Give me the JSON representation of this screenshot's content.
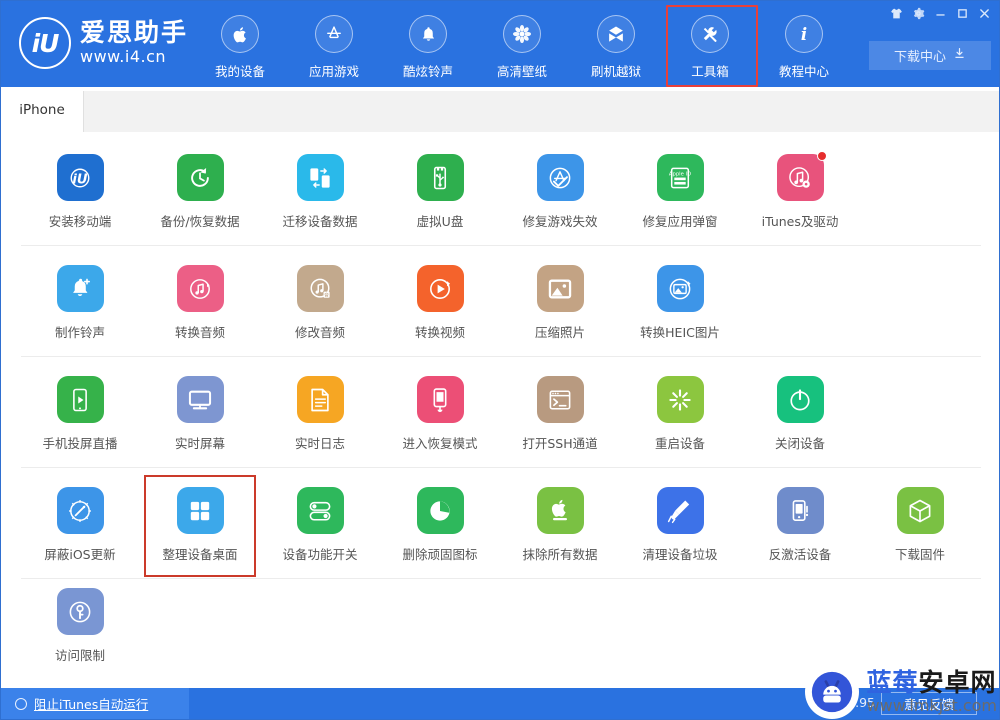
{
  "window": {
    "controls": [
      {
        "name": "skin-icon",
        "label": "换肤"
      },
      {
        "name": "settings-gear-icon",
        "label": "设置"
      },
      {
        "name": "minimize-icon",
        "label": "最小化"
      },
      {
        "name": "maximize-icon",
        "label": "最大化"
      },
      {
        "name": "close-icon",
        "label": "关闭"
      }
    ]
  },
  "brand": {
    "mark": "iU",
    "name": "爱思助手",
    "url": "www.i4.cn"
  },
  "nav": {
    "items": [
      {
        "label": "我的设备",
        "icon": "apple-icon",
        "highlighted": false
      },
      {
        "label": "应用游戏",
        "icon": "appstore-icon",
        "highlighted": false
      },
      {
        "label": "酷炫铃声",
        "icon": "bell-icon",
        "highlighted": false
      },
      {
        "label": "高清壁纸",
        "icon": "flower-icon",
        "highlighted": false
      },
      {
        "label": "刷机越狱",
        "icon": "box-icon",
        "highlighted": false
      },
      {
        "label": "工具箱",
        "icon": "wrench-icon",
        "highlighted": true
      },
      {
        "label": "教程中心",
        "icon": "info-icon",
        "highlighted": false
      }
    ],
    "download_center": {
      "label": "下载中心",
      "icon": "download-icon"
    }
  },
  "tabs": {
    "items": [
      {
        "label": "iPhone",
        "active": true
      }
    ]
  },
  "toolbox": {
    "rows": [
      {
        "items": [
          {
            "label": "安装移动端",
            "icon": "iu-app-icon",
            "color": "#1f6fd0",
            "badge": false
          },
          {
            "label": "备份/恢复数据",
            "icon": "backup-clock-icon",
            "color": "#2eaf4e",
            "badge": false
          },
          {
            "label": "迁移设备数据",
            "icon": "migrate-icon",
            "color": "#2ab9ea",
            "badge": false
          },
          {
            "label": "虚拟U盘",
            "icon": "usb-drive-icon",
            "color": "#2eaf4e",
            "badge": false
          },
          {
            "label": "修复游戏失效",
            "icon": "appstore-fix-icon",
            "color": "#3d95e8",
            "badge": false
          },
          {
            "label": "修复应用弹窗",
            "icon": "appleid-card-icon",
            "color": "#2eb85c",
            "badge": false
          },
          {
            "label": "iTunes及驱动",
            "icon": "itunes-gear-icon",
            "color": "#e8537c",
            "badge": true
          }
        ]
      },
      {
        "items": [
          {
            "label": "制作铃声",
            "icon": "bell-plus-icon",
            "color": "#3ca8ea",
            "badge": false
          },
          {
            "label": "转换音频",
            "icon": "audio-convert-icon",
            "color": "#ec5f86",
            "badge": false
          },
          {
            "label": "修改音频",
            "icon": "audio-edit-icon",
            "color": "#c2a98d",
            "badge": false
          },
          {
            "label": "转换视频",
            "icon": "video-convert-icon",
            "color": "#f4632c",
            "badge": false
          },
          {
            "label": "压缩照片",
            "icon": "photo-compress-icon",
            "color": "#c3a384",
            "badge": false
          },
          {
            "label": "转换HEIC图片",
            "icon": "heic-convert-icon",
            "color": "#3d95e8",
            "badge": false
          }
        ]
      },
      {
        "items": [
          {
            "label": "手机投屏直播",
            "icon": "screen-cast-icon",
            "color": "#36b24a",
            "badge": false
          },
          {
            "label": "实时屏幕",
            "icon": "monitor-icon",
            "color": "#7e96d1",
            "badge": false
          },
          {
            "label": "实时日志",
            "icon": "log-doc-icon",
            "color": "#f6a623",
            "badge": false
          },
          {
            "label": "进入恢复模式",
            "icon": "recovery-phone-icon",
            "color": "#ec4f76",
            "badge": false
          },
          {
            "label": "打开SSH通道",
            "icon": "ssh-terminal-icon",
            "color": "#b89a80",
            "badge": false
          },
          {
            "label": "重启设备",
            "icon": "restart-icon",
            "color": "#8cc63f",
            "badge": false
          },
          {
            "label": "关闭设备",
            "icon": "power-off-icon",
            "color": "#17c17e",
            "badge": false
          }
        ]
      },
      {
        "items": [
          {
            "label": "屏蔽iOS更新",
            "icon": "block-update-icon",
            "color": "#3d95e8",
            "badge": false
          },
          {
            "label": "整理设备桌面",
            "icon": "grid-tiles-icon",
            "color": "#3ca8ea",
            "badge": false,
            "highlighted": true
          },
          {
            "label": "设备功能开关",
            "icon": "toggles-icon",
            "color": "#2eb85c",
            "badge": false
          },
          {
            "label": "删除顽固图标",
            "icon": "pie-clock-icon",
            "color": "#2eb85c",
            "badge": false
          },
          {
            "label": "抹除所有数据",
            "icon": "apple-erase-icon",
            "color": "#7ac143",
            "badge": false
          },
          {
            "label": "清理设备垃圾",
            "icon": "broom-clean-icon",
            "color": "#3d72e8",
            "badge": false
          },
          {
            "label": "反激活设备",
            "icon": "deactivate-icon",
            "color": "#6f8ccb",
            "badge": false
          },
          {
            "label": "下载固件",
            "icon": "firmware-box-icon",
            "color": "#7ac143",
            "badge": false
          }
        ]
      },
      {
        "items": [
          {
            "label": "访问限制",
            "icon": "key-lock-icon",
            "color": "#7a96d3",
            "badge": false
          }
        ]
      }
    ]
  },
  "statusbar": {
    "block_itunes_label": "阻止iTunes自动运行",
    "version": "V7.95",
    "feedback_label": "意见反馈"
  },
  "watermark": {
    "brand_blue": "蓝莓",
    "brand_dark": "安卓网",
    "url": "www.lmkjst.com"
  },
  "colors": {
    "header_blue": "#2a72e0",
    "status_pane_blue": "#3b82ea",
    "highlight_red": "#e8403a",
    "cell_highlight_red": "#cb3a2a"
  }
}
